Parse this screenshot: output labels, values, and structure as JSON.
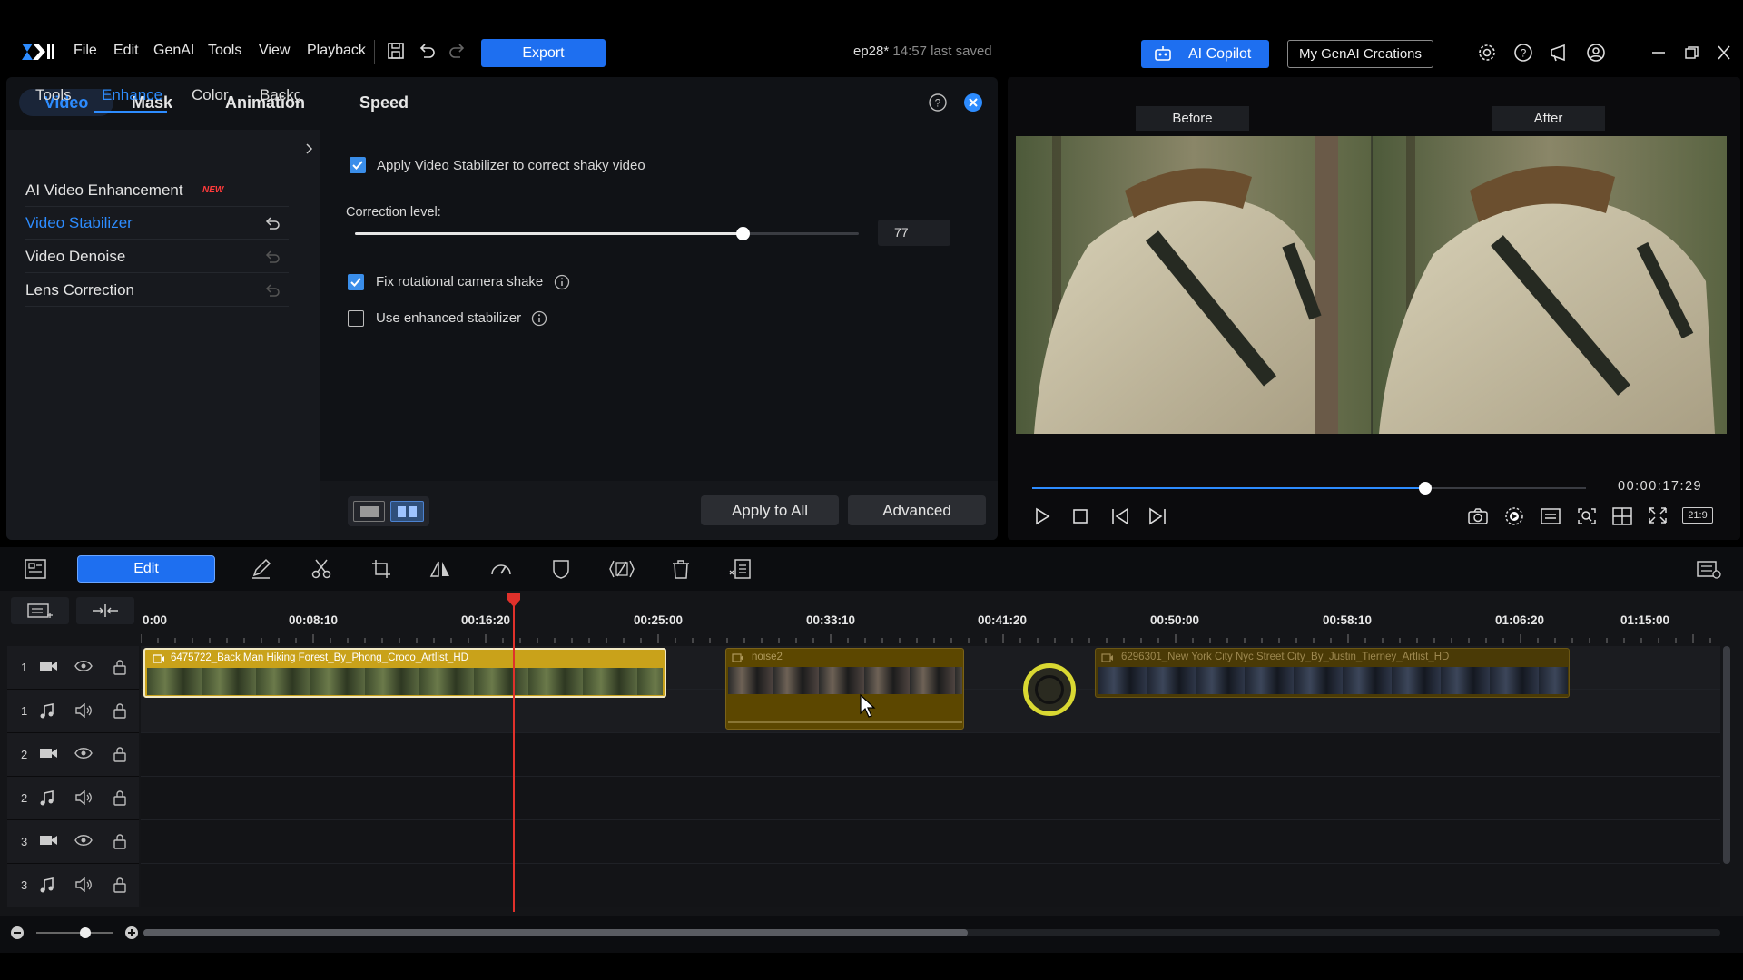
{
  "menu": {
    "items": [
      "File",
      "Edit",
      "GenAI",
      "Tools",
      "View",
      "Playback"
    ]
  },
  "toolbar": {
    "export_label": "Export"
  },
  "project": {
    "name": "ep28*",
    "saved": "14:57 last saved"
  },
  "header": {
    "copilot_label": "AI Copilot",
    "genai_label": "My GenAI Creations"
  },
  "panel": {
    "tabs": [
      "Video",
      "Mask",
      "Animation",
      "Speed"
    ],
    "subtabs": [
      "Tools",
      "Enhance",
      "Color",
      "Backg"
    ],
    "features": [
      {
        "label": "AI Video Enhancement",
        "badge": "NEW"
      },
      {
        "label": "Video Stabilizer"
      },
      {
        "label": "Video Denoise"
      },
      {
        "label": "Lens Correction"
      }
    ],
    "apply_stabilizer": "Apply Video Stabilizer to correct shaky video",
    "correction_label": "Correction level:",
    "correction_value": "77",
    "correction_level": 0.77,
    "fix_rotational": "Fix rotational camera shake",
    "use_enhanced": "Use enhanced stabilizer",
    "apply_all": "Apply to All",
    "advanced": "Advanced"
  },
  "preview": {
    "before": "Before",
    "after": "After",
    "time": "00:00:17:29",
    "ratio": "21:9",
    "progress": 0.71
  },
  "timeline": {
    "edit_label": "Edit",
    "ruler": [
      "0:00",
      "00:08:10",
      "00:16:20",
      "00:25:00",
      "00:33:10",
      "00:41:20",
      "00:50:00",
      "00:58:10",
      "01:06:20",
      "01:15:00"
    ],
    "tracks": [
      "1",
      "1",
      "2",
      "2",
      "3",
      "3"
    ],
    "clips": [
      {
        "title": "6475722_Back Man Hiking Forest_By_Phong_Croco_Artlist_HD"
      },
      {
        "title": "noise2"
      },
      {
        "title": "6296301_New York City Nyc Street City_By_Justin_Tierney_Artlist_HD"
      }
    ]
  },
  "colors": {
    "accent": "#1e6ff0",
    "clip": "#c9a21a",
    "playhead": "#e0312b"
  }
}
